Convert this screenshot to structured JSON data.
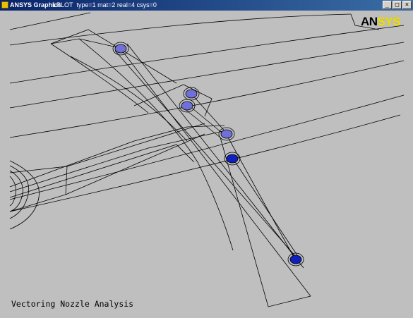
{
  "window": {
    "title": "ANSYS Graphics",
    "command_info": "LPLOT  type=1 mat=2 real=4 csys=0",
    "buttons": {
      "minimize": "_",
      "maximize": "□",
      "close": "×"
    }
  },
  "logo": {
    "part1": "AN",
    "part2": "SYS"
  },
  "caption": "Vectoring Nozzle Analysis",
  "colors": {
    "background": "#bfbfbf",
    "line": "#000000",
    "node_fill_light": "#7070d8",
    "node_fill_dark": "#1020c0",
    "logo_accent": "#f0e000"
  }
}
